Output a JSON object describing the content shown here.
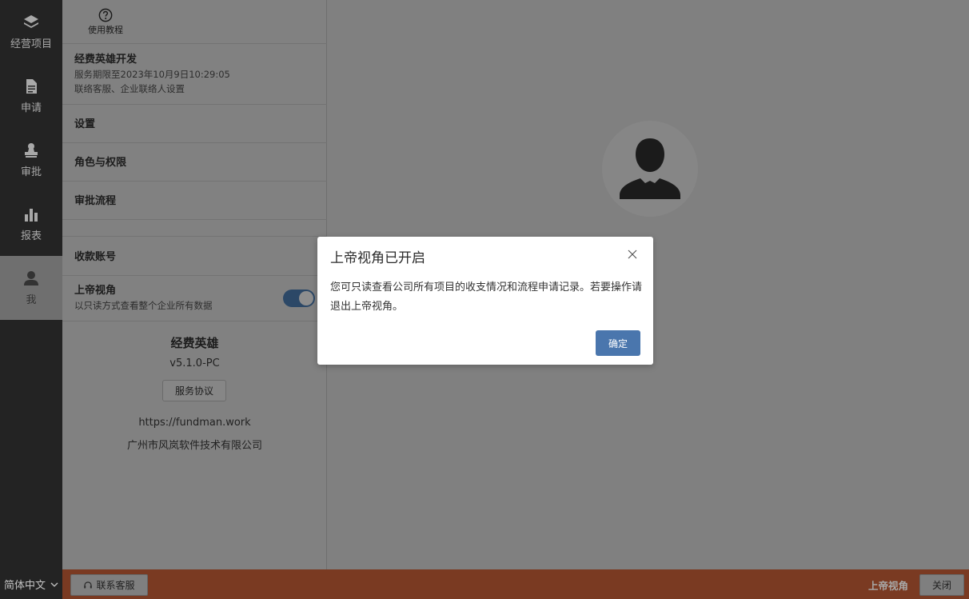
{
  "nav": {
    "items": [
      {
        "label": "经营项目",
        "icon": "layers-icon"
      },
      {
        "label": "申请",
        "icon": "document-icon"
      },
      {
        "label": "审批",
        "icon": "stamp-icon"
      },
      {
        "label": "报表",
        "icon": "bar-chart-icon"
      },
      {
        "label": "我",
        "icon": "user-icon",
        "active": true
      }
    ]
  },
  "panel": {
    "help_label": "使用教程",
    "account": {
      "title": "经费英雄开发",
      "expiry": "服务期限至2023年10月9日10:29:05",
      "contact": "联络客服、企业联络人设置"
    },
    "menu": [
      "设置",
      "角色与权限",
      "审批流程",
      "收款账号"
    ],
    "god_view": {
      "title": "上帝视角",
      "desc": "以只读方式查看整个企业所有数据",
      "enabled": true
    },
    "about": {
      "name": "经费英雄",
      "version": "v5.1.0-PC",
      "agreement_btn": "服务协议",
      "url": "https://fundman.work",
      "company": "广州市风岚软件技术有限公司"
    }
  },
  "bottom": {
    "language": "简体中文",
    "support_btn": "联系客服",
    "god_label": "上帝视角",
    "close_btn": "关闭"
  },
  "modal": {
    "title": "上帝视角已开启",
    "body": "您可只读查看公司所有项目的收支情况和流程申请记录。若要操作请退出上帝视角。",
    "ok": "确定"
  },
  "colors": {
    "accent": "#4a76ad",
    "bottom_bar": "#7a3a22",
    "nav_bg": "#232323"
  }
}
